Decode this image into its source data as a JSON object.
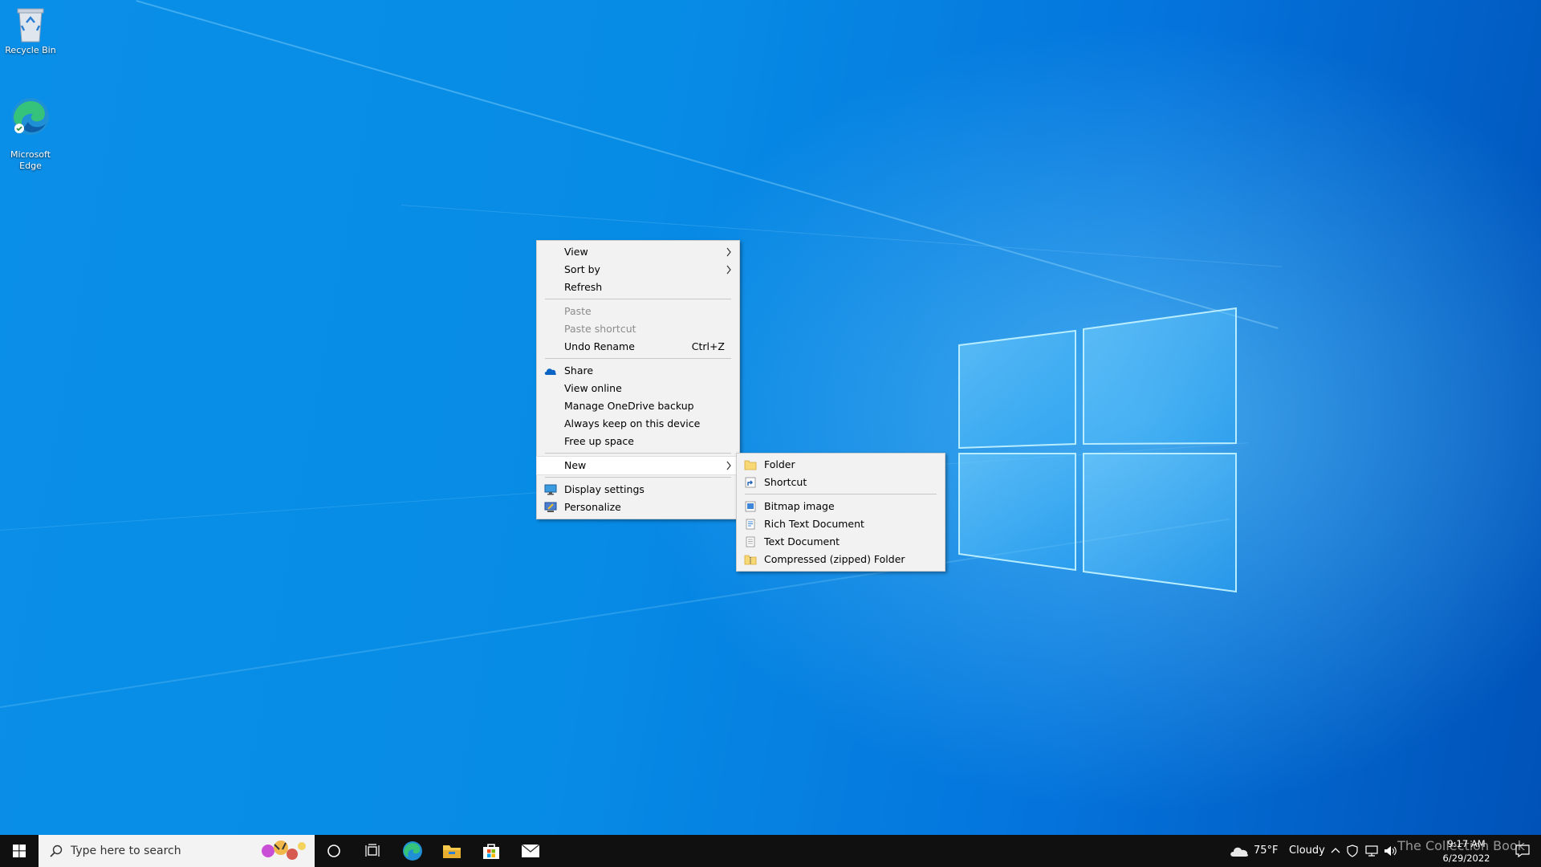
{
  "desktop": {
    "icons": [
      {
        "label": "Recycle Bin"
      },
      {
        "label": "Microsoft\nEdge"
      }
    ]
  },
  "context_menu": {
    "view": "View",
    "sort_by": "Sort by",
    "refresh": "Refresh",
    "paste": "Paste",
    "paste_shortcut": "Paste shortcut",
    "undo_rename": "Undo Rename",
    "undo_shortcut": "Ctrl+Z",
    "share": "Share",
    "view_online": "View online",
    "manage_onedrive": "Manage OneDrive backup",
    "always_keep": "Always keep on this device",
    "free_up_space": "Free up space",
    "new": "New",
    "display_settings": "Display settings",
    "personalize": "Personalize"
  },
  "new_submenu": {
    "folder": "Folder",
    "shortcut": "Shortcut",
    "bitmap": "Bitmap image",
    "rich_text": "Rich Text Document",
    "text_doc": "Text Document",
    "zip_folder": "Compressed (zipped) Folder"
  },
  "taskbar": {
    "search_placeholder": "Type here to search",
    "weather_temp": "75°F",
    "weather_desc": "Cloudy",
    "time": "9:17 AM",
    "date": "6/29/2022",
    "watermark": "The Collection Book"
  },
  "colors": {
    "accent": "#0078d7",
    "taskbar": "#101010",
    "menu_bg": "#f2f2f2"
  }
}
